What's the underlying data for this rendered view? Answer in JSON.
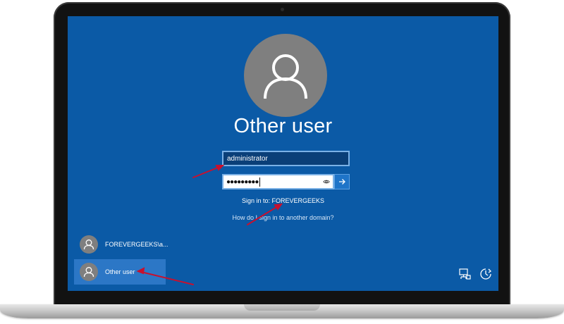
{
  "screen": {
    "title": "Other user",
    "username": {
      "value": "administrator"
    },
    "password": {
      "masked": "●●●●●●●●●"
    },
    "sign_in_to": "Sign in to: FOREVERGEEKS",
    "other_domain_link": "How do I sign in to another domain?"
  },
  "user_list": [
    {
      "label": "FOREVERGEEKS\\a...",
      "selected": false
    },
    {
      "label": "Other user",
      "selected": true
    }
  ],
  "icons": {
    "avatar": "user-icon",
    "reveal": "eye-icon",
    "submit": "arrow-right-icon",
    "network": "network-icon",
    "ease_of_access": "ease-of-access-icon",
    "power": "power-icon"
  },
  "colors": {
    "screen_bg": "#0b5aa6",
    "selected_item": "#2c77c6",
    "annotation": "#c8102e"
  }
}
